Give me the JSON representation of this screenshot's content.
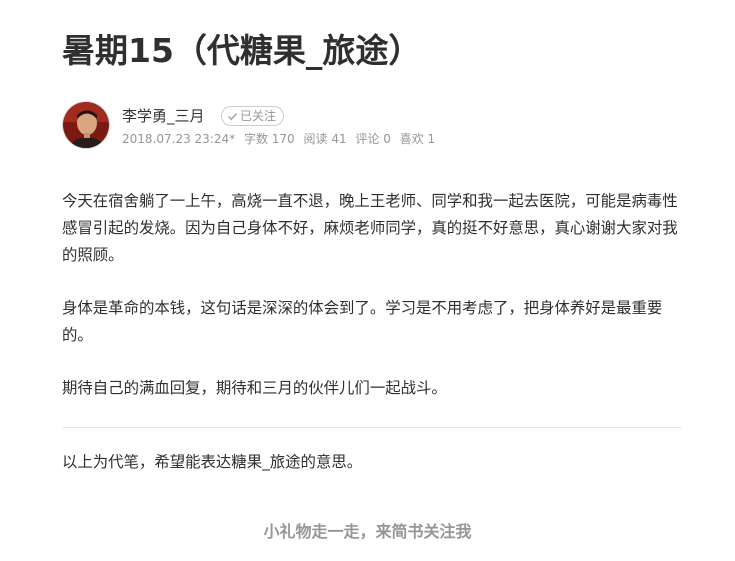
{
  "article": {
    "title": "暑期15（代糖果_旅途）",
    "author": {
      "name": "李学勇_三月",
      "follow_label": "已关注",
      "avatar_icon": "user-avatar"
    },
    "meta": {
      "datetime": "2018.07.23 23:24*",
      "word_count": "字数 170",
      "reads": "阅读 41",
      "comments": "评论 0",
      "likes": "喜欢 1"
    },
    "paragraphs": [
      "今天在宿舍躺了一上午，高烧一直不退，晚上王老师、同学和我一起去医院，可能是病毒性感冒引起的发烧。因为自己身体不好，麻烦老师同学，真的挺不好意思，真心谢谢大家对我的照顾。",
      "身体是革命的本钱，这句话是深深的体会到了。学习是不用考虑了，把身体养好是最重要的。",
      "期待自己的满血回复，期待和三月的伙伴儿们一起战斗。"
    ],
    "footnote": "以上为代笔，希望能表达糖果_旅途的意思。",
    "reward_text": "小礼物走一走，来简书关注我"
  },
  "colors": {
    "text": "#2f2f2f",
    "muted": "#969696",
    "divider": "#e6e6e6"
  }
}
